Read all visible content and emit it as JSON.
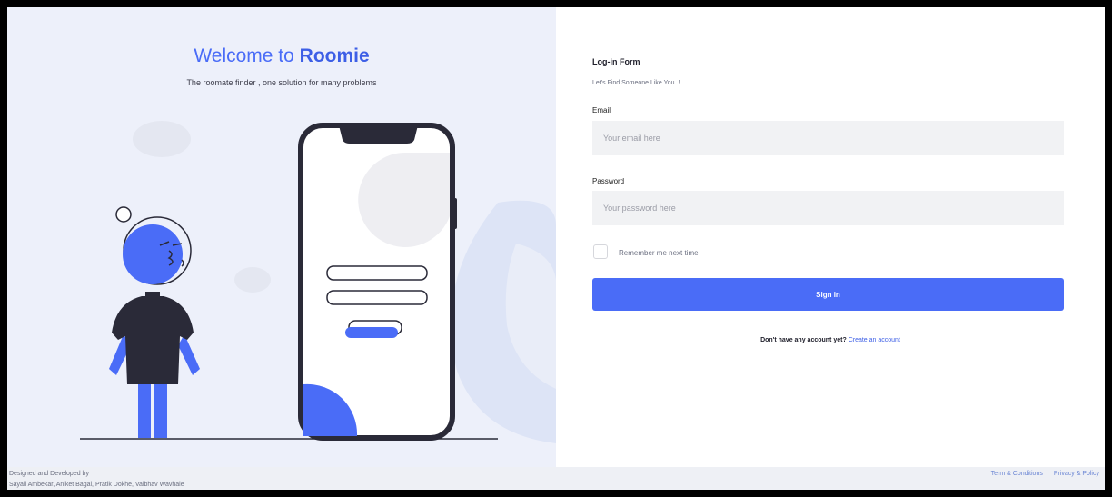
{
  "hero": {
    "welcome_prefix": "Welcome to ",
    "brand": "Roomie",
    "tagline": "The roomate finder , one solution for many problems"
  },
  "form": {
    "title": "Log-in Form",
    "subtitle": "Let's Find Someone Like You..!",
    "email_label": "Email",
    "email_placeholder": "Your email here",
    "password_label": "Password",
    "password_placeholder": "Your password here",
    "remember_label": "Remember me next time",
    "signin_label": "Sign in",
    "no_account_text": "Don't have any account yet?",
    "create_account_link": "Create an account"
  },
  "footer": {
    "credits_line1": "Designed and Developed by",
    "credits_line2": "Sayali Ambekar, Aniket Bagal, Pratik Dokhe, Vaibhav Wavhale",
    "terms_link": "Term & Conditions",
    "privacy_link": "Privacy & Policy"
  },
  "colors": {
    "accent": "#4a6cf7",
    "left_background": "#edf0fa",
    "dark": "#2a2a38"
  }
}
